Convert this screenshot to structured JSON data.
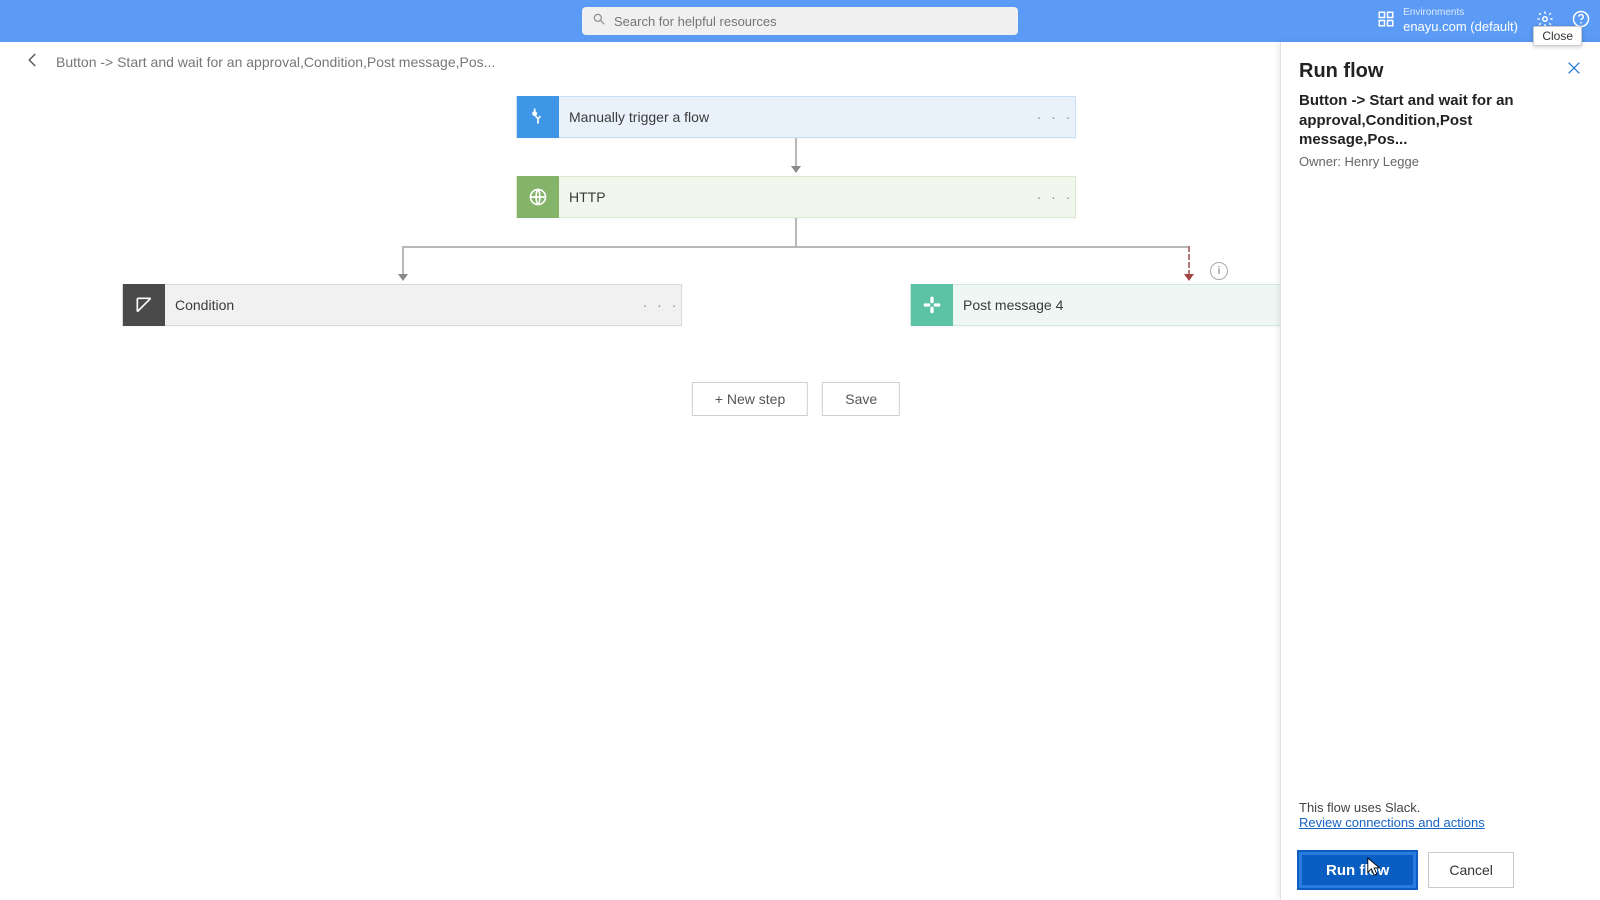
{
  "header": {
    "search_placeholder": "Search for helpful resources",
    "env_label": "Environments",
    "env_name": "enayu.com (default)",
    "close_tooltip": "Close"
  },
  "breadcrumb": {
    "title": "Button -> Start and wait for an approval,Condition,Post message,Pos..."
  },
  "cards": {
    "trigger": {
      "title": "Manually trigger a flow"
    },
    "http": {
      "title": "HTTP"
    },
    "condition": {
      "title": "Condition"
    },
    "post": {
      "title": "Post message 4"
    }
  },
  "actions": {
    "new_step": "+ New step",
    "save": "Save"
  },
  "panel": {
    "title": "Run flow",
    "subtitle": "Button -> Start and wait for an approval,Condition,Post message,Pos...",
    "owner": "Owner: Henry Legge",
    "note": "This flow uses Slack.",
    "link": "Review connections and actions",
    "run": "Run flow",
    "cancel": "Cancel"
  }
}
